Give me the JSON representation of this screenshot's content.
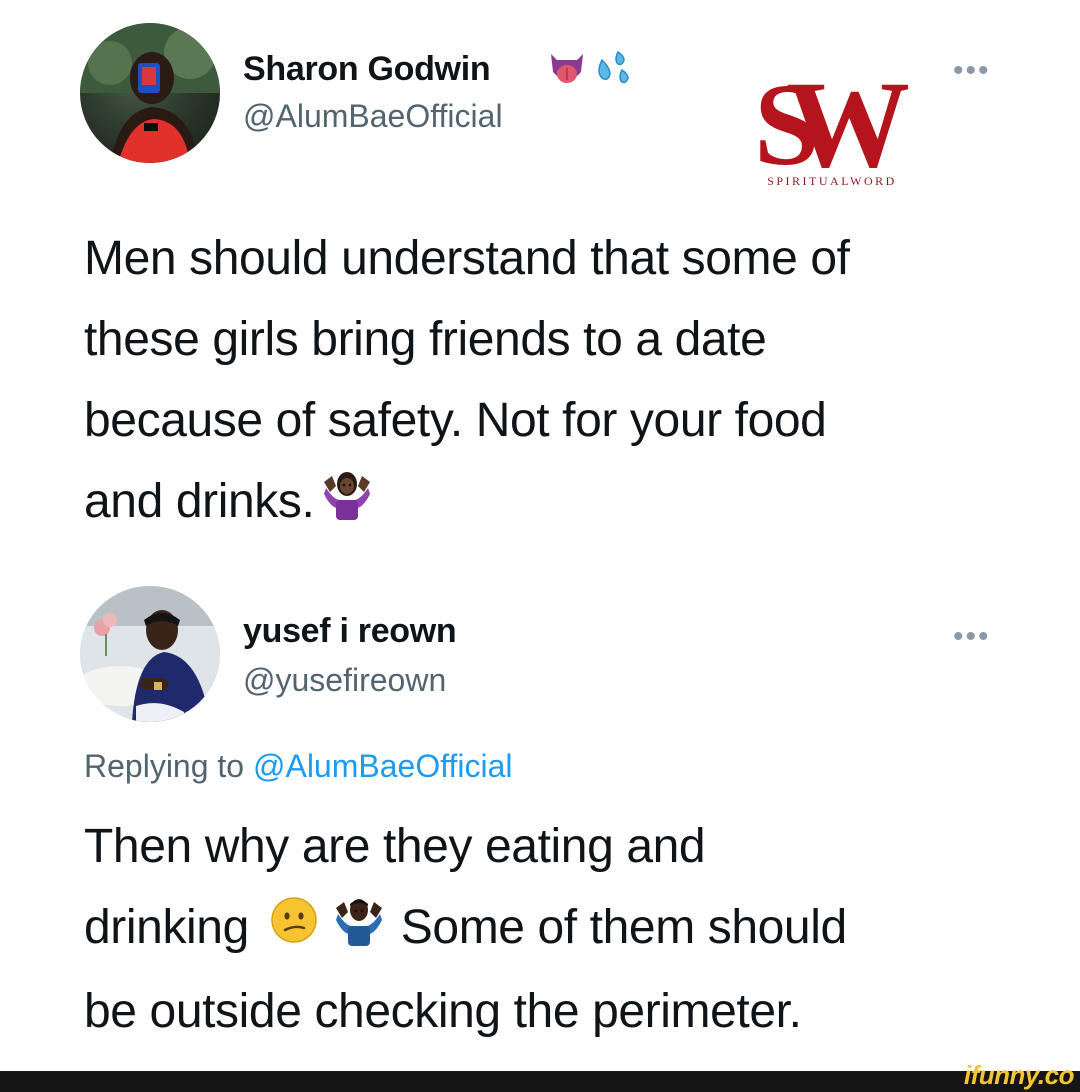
{
  "tweet": {
    "author_name": "Sharon Godwin",
    "author_handle": "@AlumBaeOfficial",
    "name_emojis": [
      "tongue-emoji",
      "sweat-droplets-emoji"
    ],
    "text_lines": [
      "Men should understand that some of",
      "these girls bring friends to a date",
      "because of safety. Not for your food",
      "and drinks."
    ],
    "more_label": "•••"
  },
  "reply": {
    "author_name": "yusef i reown",
    "author_handle": "@yusefireown",
    "replying_prefix": "Replying to ",
    "replying_mention": "@AlumBaeOfficial",
    "text_lines": [
      "Then why are they eating and",
      "drinking",
      " Some of them should",
      "be outside checking the perimeter."
    ],
    "more_label": "•••"
  },
  "watermark": {
    "logo_letters": "SW",
    "caption": "SPIRITUALWORD",
    "color": "#b5141d"
  },
  "footer": {
    "brand": "ifunny.co",
    "bar_color": "#151515",
    "brand_color": "#f6c431"
  }
}
